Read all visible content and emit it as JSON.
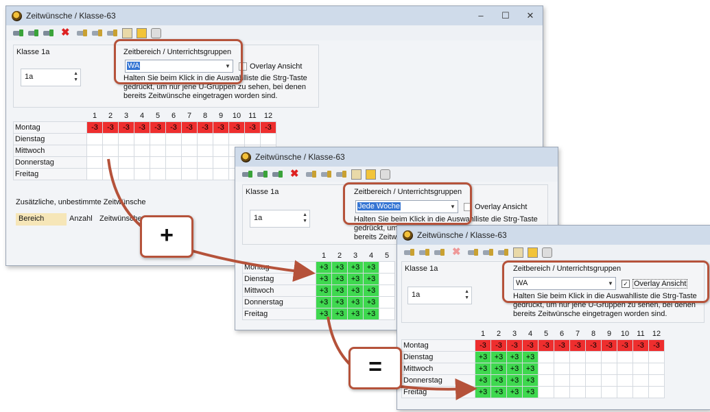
{
  "windows": [
    {
      "title": "Zeitwünsche / Klasse-63",
      "klasse_label": "Klasse 1a",
      "klasse_value": "1a",
      "zeitbereich_label": "Zeitbereich / Unterrichtsgruppen",
      "combo_value": "WA",
      "overlay_label": "Overlay Ansicht",
      "overlay_checked": false,
      "hint": "Halten Sie beim Klick in die Auswahlliste die Strg-Taste gedrückt, um nur jene U-Gruppen zu sehen, bei denen bereits Zeitwünsche eingetragen worden sind.",
      "zus_label": "Zusätzliche, unbestimmte Zeitwünsche",
      "tabs": [
        "Bereich",
        "Anzahl",
        "Zeitwünsche"
      ]
    },
    {
      "title": "Zeitwünsche / Klasse-63",
      "klasse_label": "Klasse 1a",
      "klasse_value": "1a",
      "zeitbereich_label": "Zeitbereich / Unterrichtsgruppen",
      "combo_value": "Jede Woche",
      "overlay_label": "Overlay Ansicht",
      "overlay_checked": false,
      "hint": "Halten Sie beim Klick in die Auswahlliste die Strg-Taste gedrückt, um nur jene U-Gruppen zu sehen, bei denen bereits Zeitwünsche eingetragen worden sind."
    },
    {
      "title": "Zeitwünsche / Klasse-63",
      "klasse_label": "Klasse 1a",
      "klasse_value": "1a",
      "zeitbereich_label": "Zeitbereich / Unterrichtsgruppen",
      "combo_value": "WA",
      "overlay_label": "Overlay Ansicht",
      "overlay_checked": true,
      "hint": "Halten Sie beim Klick in die Auswahlliste die Strg-Taste gedrückt, um nur jene U-Gruppen zu sehen, bei denen bereits Zeitwünsche eingetragen worden sind."
    }
  ],
  "window_buttons": [
    "–",
    "☐",
    "✕"
  ],
  "days": [
    "Montag",
    "Dienstag",
    "Mittwoch",
    "Donnerstag",
    "Freitag"
  ],
  "grid1": {
    "cols": [
      "1",
      "2",
      "3",
      "4",
      "5",
      "6",
      "7",
      "8",
      "9",
      "10",
      "11",
      "12"
    ],
    "rows": [
      [
        "-3",
        "-3",
        "-3",
        "-3",
        "-3",
        "-3",
        "-3",
        "-3",
        "-3",
        "-3",
        "-3",
        "-3"
      ],
      [
        "",
        "",
        "",
        "",
        "",
        "",
        "",
        "",
        "",
        "",
        "",
        ""
      ],
      [
        "",
        "",
        "",
        "",
        "",
        "",
        "",
        "",
        "",
        "",
        "",
        ""
      ],
      [
        "",
        "",
        "",
        "",
        "",
        "",
        "",
        "",
        "",
        "",
        "",
        ""
      ],
      [
        "",
        "",
        "",
        "",
        "",
        "",
        "",
        "",
        "",
        "",
        "",
        ""
      ]
    ]
  },
  "grid2": {
    "cols": [
      "1",
      "2",
      "3",
      "4",
      "5"
    ],
    "rows": [
      [
        "+3",
        "+3",
        "+3",
        "+3",
        ""
      ],
      [
        "+3",
        "+3",
        "+3",
        "+3",
        ""
      ],
      [
        "+3",
        "+3",
        "+3",
        "+3",
        ""
      ],
      [
        "+3",
        "+3",
        "+3",
        "+3",
        ""
      ],
      [
        "+3",
        "+3",
        "+3",
        "+3",
        ""
      ]
    ]
  },
  "grid3": {
    "cols": [
      "1",
      "2",
      "3",
      "4",
      "5",
      "6",
      "7",
      "8",
      "9",
      "10",
      "11",
      "12"
    ],
    "rows": [
      [
        "-3",
        "-3",
        "-3",
        "-3",
        "-3",
        "-3",
        "-3",
        "-3",
        "-3",
        "-3",
        "-3",
        "-3"
      ],
      [
        "+3",
        "+3",
        "+3",
        "+3",
        "",
        "",
        "",
        "",
        "",
        "",
        "",
        ""
      ],
      [
        "+3",
        "+3",
        "+3",
        "+3",
        "",
        "",
        "",
        "",
        "",
        "",
        "",
        ""
      ],
      [
        "+3",
        "+3",
        "+3",
        "+3",
        "",
        "",
        "",
        "",
        "",
        "",
        "",
        ""
      ],
      [
        "+3",
        "+3",
        "+3",
        "+3",
        "",
        "",
        "",
        "",
        "",
        "",
        "",
        ""
      ]
    ]
  },
  "ops": {
    "plus": "+",
    "equals": "="
  },
  "colors": {
    "negative": "#ee2e2e",
    "positive": "#3fd84f",
    "highlight": "#b5523a"
  }
}
